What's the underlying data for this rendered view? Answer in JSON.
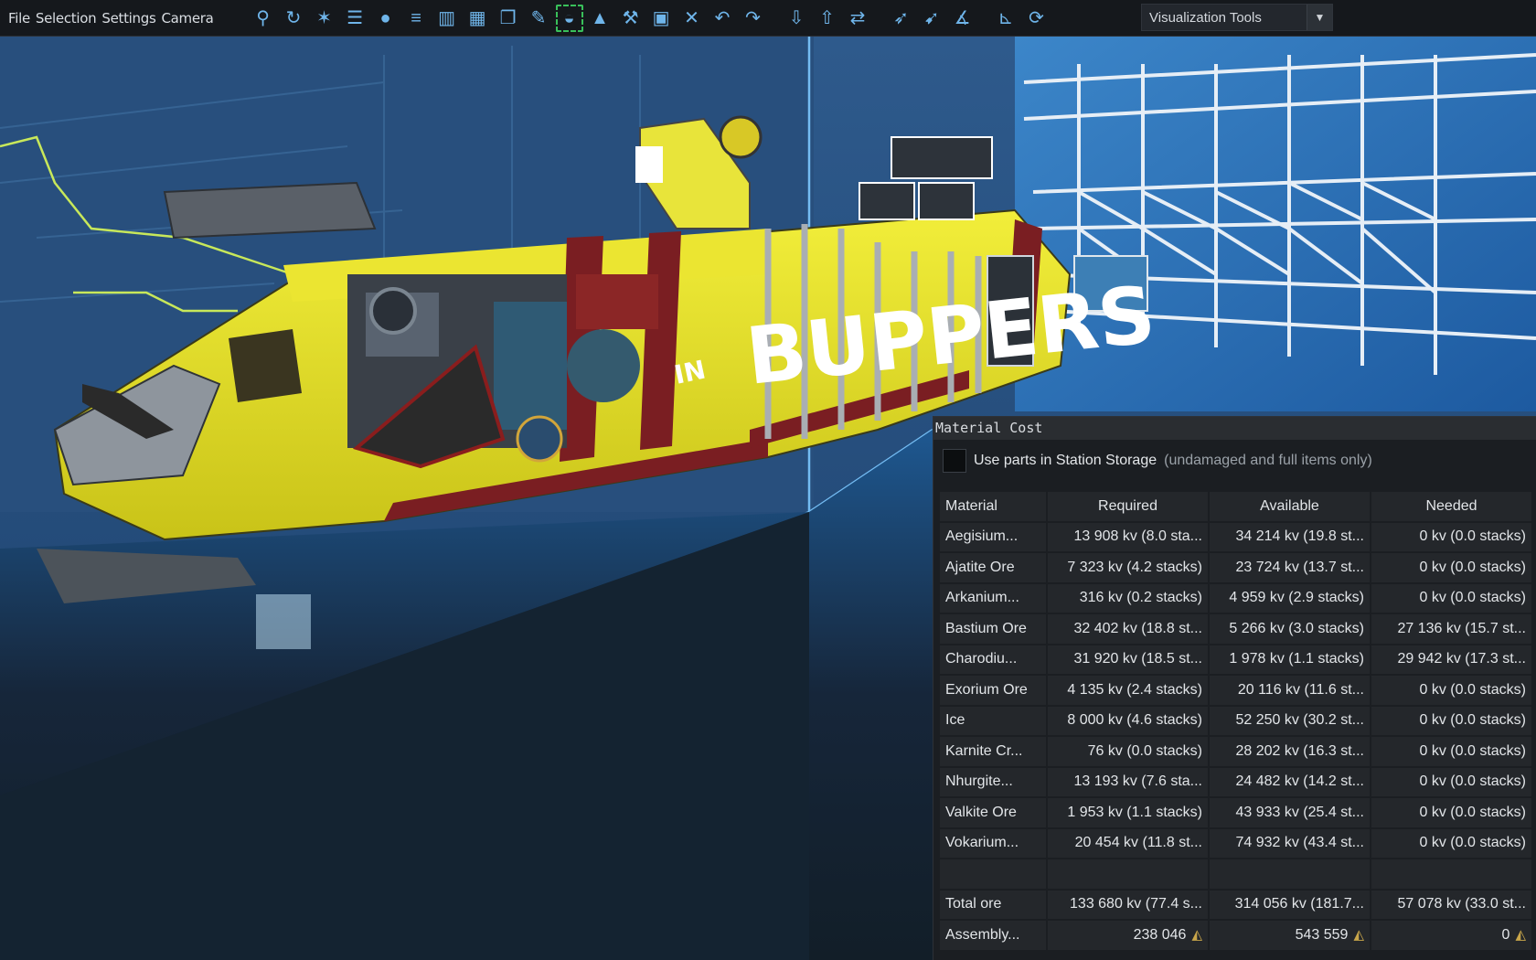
{
  "menu": [
    "File",
    "Selection",
    "Settings",
    "Camera"
  ],
  "toolbar": {
    "icons": [
      {
        "name": "view-icon",
        "glyph": "⚲"
      },
      {
        "name": "rotate-view-icon",
        "glyph": "↻"
      },
      {
        "name": "tools-icon",
        "glyph": "✶"
      },
      {
        "name": "list-icon",
        "glyph": "☰"
      },
      {
        "name": "sphere-icon",
        "glyph": "●"
      },
      {
        "name": "layers-icon",
        "glyph": "≡"
      },
      {
        "name": "bar-chart-icon",
        "glyph": "▥"
      },
      {
        "name": "grid-select-icon",
        "glyph": "▦"
      },
      {
        "name": "copy-icon",
        "glyph": "❐"
      },
      {
        "name": "paint-icon",
        "glyph": "✎"
      },
      {
        "name": "weight-icon",
        "glyph": "◒"
      },
      {
        "name": "lock-icon",
        "glyph": "▲"
      },
      {
        "name": "wrench-icon",
        "glyph": "⚒"
      },
      {
        "name": "save-icon",
        "glyph": "▣"
      },
      {
        "name": "delete-icon",
        "glyph": "✕"
      },
      {
        "name": "undo-icon",
        "glyph": "↶"
      },
      {
        "name": "redo-icon",
        "glyph": "↷"
      },
      {
        "name": "import-icon",
        "glyph": "⇩"
      },
      {
        "name": "export-icon",
        "glyph": "⇧"
      },
      {
        "name": "transfer-icon",
        "glyph": "⇄"
      },
      {
        "name": "pin-icon",
        "glyph": "➶"
      },
      {
        "name": "brush-icon",
        "glyph": "➹"
      },
      {
        "name": "angle-icon",
        "glyph": "∡"
      },
      {
        "name": "axis-icon",
        "glyph": "⊾"
      },
      {
        "name": "refresh-icon",
        "glyph": "⟳"
      }
    ],
    "selected_index": 10,
    "dropdown_label": "Visualization Tools",
    "dropdown_arrow": "▼"
  },
  "material_panel": {
    "title": "Material Cost",
    "storage_label": "Use parts in Station Storage",
    "storage_note": "(undamaged and full items only)",
    "columns": [
      "Material",
      "Required",
      "Available",
      "Needed"
    ],
    "rows": [
      {
        "material": "Aegisium...",
        "required": "13 908 kv (8.0 sta...",
        "available": "34 214 kv (19.8 st...",
        "needed": "0 kv (0.0 stacks)",
        "available_status": "ok",
        "needed_status": "ok"
      },
      {
        "material": "Ajatite Ore",
        "required": "7 323 kv (4.2 stacks)",
        "available": "23 724 kv (13.7 st...",
        "needed": "0 kv (0.0 stacks)",
        "available_status": "ok",
        "needed_status": "ok"
      },
      {
        "material": "Arkanium...",
        "required": "316 kv (0.2 stacks)",
        "available": "4 959 kv (2.9 stacks)",
        "needed": "0 kv (0.0 stacks)",
        "available_status": "ok",
        "needed_status": "ok"
      },
      {
        "material": "Bastium Ore",
        "required": "32 402 kv (18.8 st...",
        "available": "5 266 kv (3.0 stacks)",
        "needed": "27 136 kv (15.7 st...",
        "available_status": "bad",
        "needed_status": "bad"
      },
      {
        "material": "Charodiu...",
        "required": "31 920 kv (18.5 st...",
        "available": "1 978 kv (1.1 stacks)",
        "needed": "29 942 kv (17.3 st...",
        "available_status": "bad",
        "needed_status": "bad"
      },
      {
        "material": "Exorium Ore",
        "required": "4 135 kv (2.4 stacks)",
        "available": "20 116 kv (11.6 st...",
        "needed": "0 kv (0.0 stacks)",
        "available_status": "ok",
        "needed_status": "ok"
      },
      {
        "material": "Ice",
        "required": "8 000 kv (4.6 stacks)",
        "available": "52 250 kv (30.2 st...",
        "needed": "0 kv (0.0 stacks)",
        "available_status": "ok",
        "needed_status": "ok"
      },
      {
        "material": "Karnite Cr...",
        "required": "76 kv (0.0 stacks)",
        "available": "28 202 kv (16.3 st...",
        "needed": "0 kv (0.0 stacks)",
        "available_status": "ok",
        "needed_status": "ok"
      },
      {
        "material": "Nhurgite...",
        "required": "13 193 kv (7.6 sta...",
        "available": "24 482 kv (14.2 st...",
        "needed": "0 kv (0.0 stacks)",
        "available_status": "ok",
        "needed_status": "ok"
      },
      {
        "material": "Valkite Ore",
        "required": "1 953 kv (1.1 stacks)",
        "available": "43 933 kv (25.4 st...",
        "needed": "0 kv (0.0 stacks)",
        "available_status": "ok",
        "needed_status": "ok"
      },
      {
        "material": "Vokarium...",
        "required": "20 454 kv (11.8 st...",
        "available": "74 932 kv (43.4 st...",
        "needed": "0 kv (0.0 stacks)",
        "available_status": "ok",
        "needed_status": "ok"
      }
    ],
    "total": {
      "material": "Total ore",
      "required": "133 680 kv (77.4 s...",
      "available": "314 056 kv (181.7...",
      "needed": "57 078 kv (33.0 st..."
    },
    "assembly": {
      "material": "Assembly...",
      "required": "238 046",
      "available": "543 559",
      "needed": "0"
    },
    "colors": {
      "ok": "#7fd17a",
      "bad": "#ff5a5a",
      "ship_yellow": "#e8e62a",
      "ship_stripe": "#7a1e22"
    }
  },
  "ship": {
    "hull_text": "BUPPERS",
    "badge_text": "IN"
  }
}
